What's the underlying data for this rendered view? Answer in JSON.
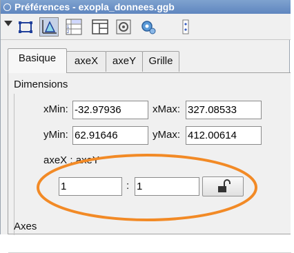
{
  "window": {
    "title": "Préférences - exopla_donnees.ggb"
  },
  "toolbar": {
    "icons": [
      "menu-arrow",
      "object-properties-icon",
      "graphics-icon",
      "cas-icon",
      "layout-icon",
      "defaults-icon",
      "settings-icon",
      "advanced-icon"
    ]
  },
  "tabs": [
    {
      "label": "Basique",
      "active": true
    },
    {
      "label": "axeX",
      "active": false
    },
    {
      "label": "axeY",
      "active": false
    },
    {
      "label": "Grille",
      "active": false
    }
  ],
  "dimensions": {
    "title": "Dimensions",
    "xmin_label": "xMin:",
    "xmin_value": "-32.97936",
    "xmax_label": "xMax:",
    "xmax_value": "327.08533",
    "ymin_label": "yMin:",
    "ymin_value": "62.91646",
    "ymax_label": "yMax:",
    "ymax_value": "412.00614",
    "ratio_label": "axeX : axeY",
    "ratio_x": "1",
    "ratio_sep": ":",
    "ratio_y": "1"
  },
  "axes": {
    "title": "Axes"
  },
  "colors": {
    "title_bar": "#6a8fc6",
    "annotation": "#f28a26",
    "selected_tool": "#c6d2e6"
  }
}
